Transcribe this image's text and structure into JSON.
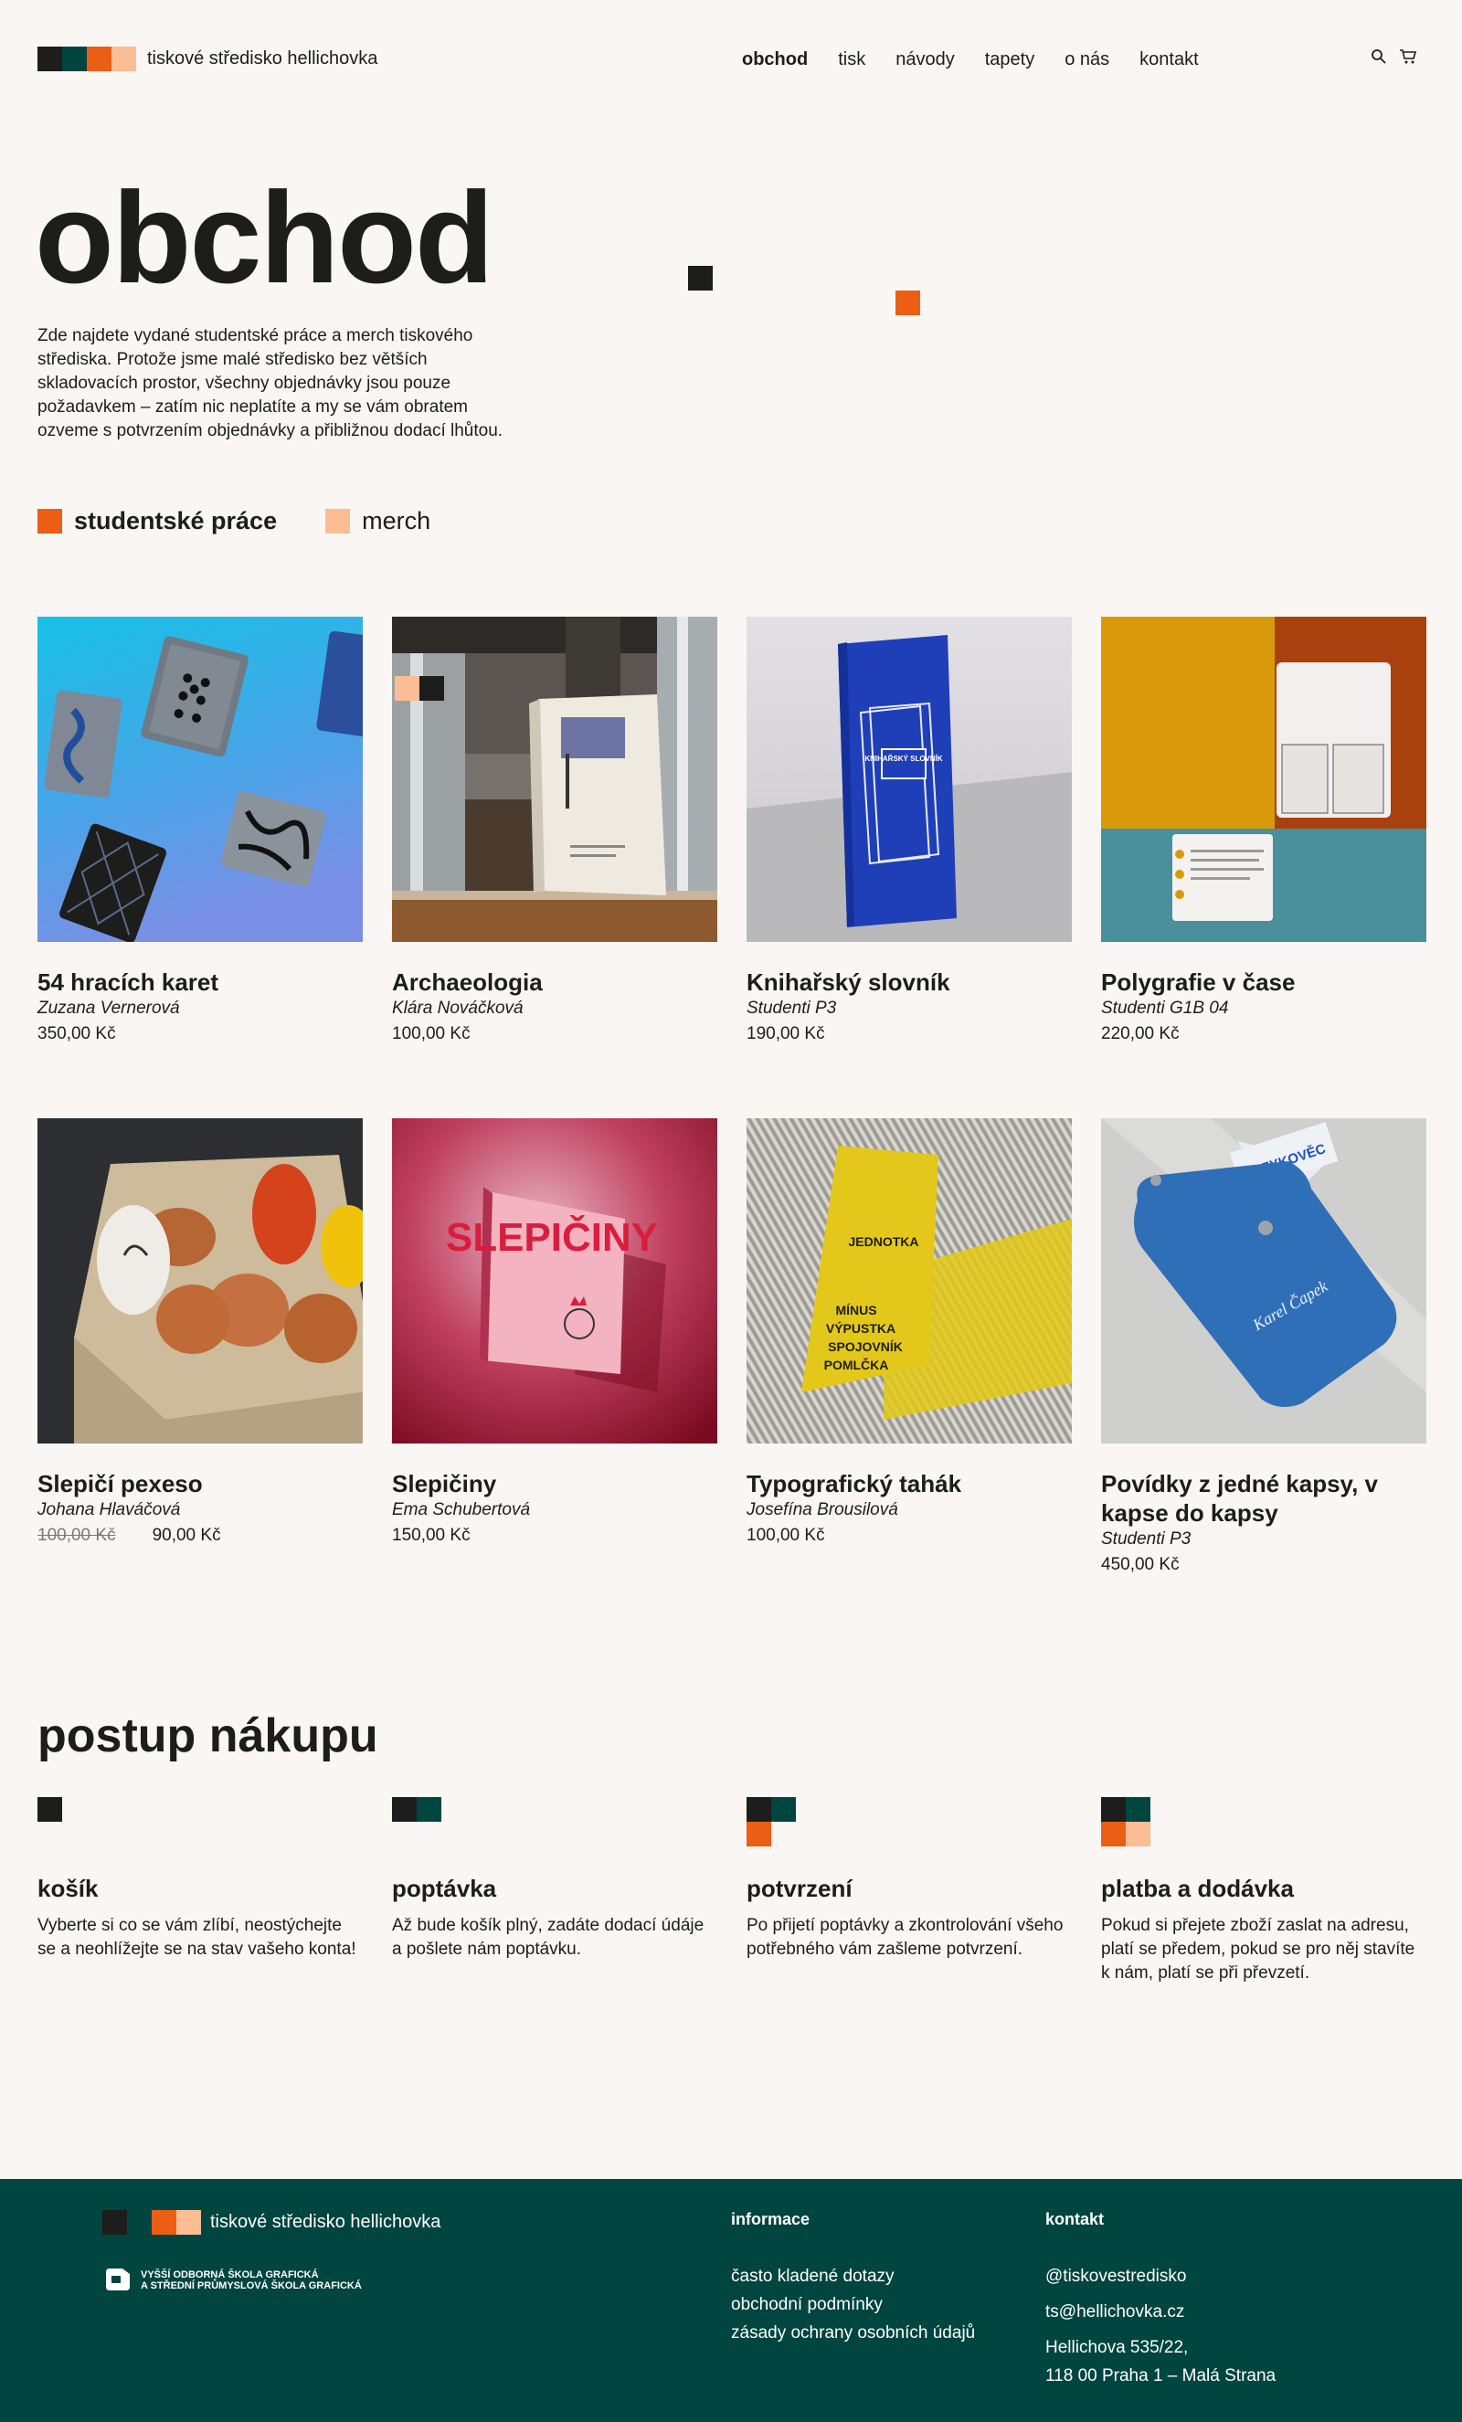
{
  "brand": {
    "name": "tiskové středisko hellichovka",
    "colors": {
      "dark": "#1d1d1b",
      "green": "#004540",
      "orange": "#ec5e14",
      "peach": "#fdbd94",
      "bg": "#f9f6f3"
    }
  },
  "nav": [
    {
      "label": "obchod",
      "active": true
    },
    {
      "label": "tisk"
    },
    {
      "label": "návody"
    },
    {
      "label": "tapety"
    },
    {
      "label": "o nás"
    },
    {
      "label": "kontakt"
    }
  ],
  "header_icons": [
    "search-icon",
    "cart-icon"
  ],
  "hero": {
    "title": "obchod",
    "description": "Zde najdete vydané studentské práce a merch tiskového střediska. Protože jsme malé středisko bez větších skladovacích prostor, všechny objednávky jsou pouze požadavkem – zatím nic neplatíte a my se vám obratem ozveme s potvrzením objednávky a přibližnou dodací lhůtou."
  },
  "filters": [
    {
      "label": "studentské práce",
      "active": true,
      "color": "#ec5e14"
    },
    {
      "label": "merch",
      "active": false,
      "color": "#fdbd94"
    }
  ],
  "products": [
    {
      "name": "54 hracích karet",
      "author": "Zuzana Vernerová",
      "price": "350,00 Kč"
    },
    {
      "name": "Archaeologia",
      "author": "Klára Nováčková",
      "price": "100,00 Kč"
    },
    {
      "name": "Knihařský slovník",
      "author": "Studenti P3",
      "price": "190,00 Kč"
    },
    {
      "name": "Polygrafie v čase",
      "author": "Studenti G1B 04",
      "price": "220,00 Kč"
    },
    {
      "name": "Slepičí pexeso",
      "author": "Johana Hlaváčová",
      "old_price": "100,00 Kč",
      "price": "90,00 Kč"
    },
    {
      "name": "Slepičiny",
      "author": "Ema Schubertová",
      "price": "150,00 Kč"
    },
    {
      "name": "Typografický tahák",
      "author": "Josefína Brousilová",
      "price": "100,00 Kč"
    },
    {
      "name": "Povídky z jedné kapsy, v kapse do kapsy",
      "author": "Studenti P3",
      "price": "450,00 Kč"
    }
  ],
  "images": {
    "book_title": "KNIHAŘSKÝ SLOVNÍK",
    "slepiciny_cover": "SLEPIČINY",
    "tahak_words": [
      "JEDNOTKA",
      "MÍNUS",
      "VÝPUSTKA",
      "SPOJOVNÍK",
      "POMLČKA"
    ],
    "kapsa_author": "Karel Čapek",
    "kapsa_label": "JAZYKOVĚC"
  },
  "process": {
    "title": "postup nákupu",
    "steps": [
      {
        "title": "košík",
        "text": "Vyberte si co se vám zlíbí, neostýchejte se a neohlížejte se na stav vašeho konta!"
      },
      {
        "title": "poptávka",
        "text": "Až bude košík plný, zadáte dodací údáje a pošlete nám poptávku."
      },
      {
        "title": "potvrzení",
        "text": "Po přijetí poptávky a zkontrolování všeho potřebného vám zašleme potvrzení."
      },
      {
        "title": "platba a dodávka",
        "text": "Pokud si přejete zboží zaslat na adresu, platí se předem, pokud se pro něj stavíte k nám, platí se při převzetí."
      }
    ]
  },
  "footer": {
    "brand": "tiskové středisko hellichovka",
    "school_line1": "VYŠŠÍ ODBORNÁ ŠKOLA GRAFICKÁ",
    "school_line2": "A STŘEDNÍ PRŮMYSLOVÁ ŠKOLA GRAFICKÁ",
    "info_title": "informace",
    "info_links": [
      "často kladené dotazy",
      "obchodní podmínky",
      "zásady ochrany osobních údajů"
    ],
    "contact_title": "kontakt",
    "instagram": "@tiskovestredisko",
    "email": "ts@hellichovka.cz",
    "address_line1": "Hellichova 535/22,",
    "address_line2": "118 00 Praha 1 – Malá Strana"
  }
}
